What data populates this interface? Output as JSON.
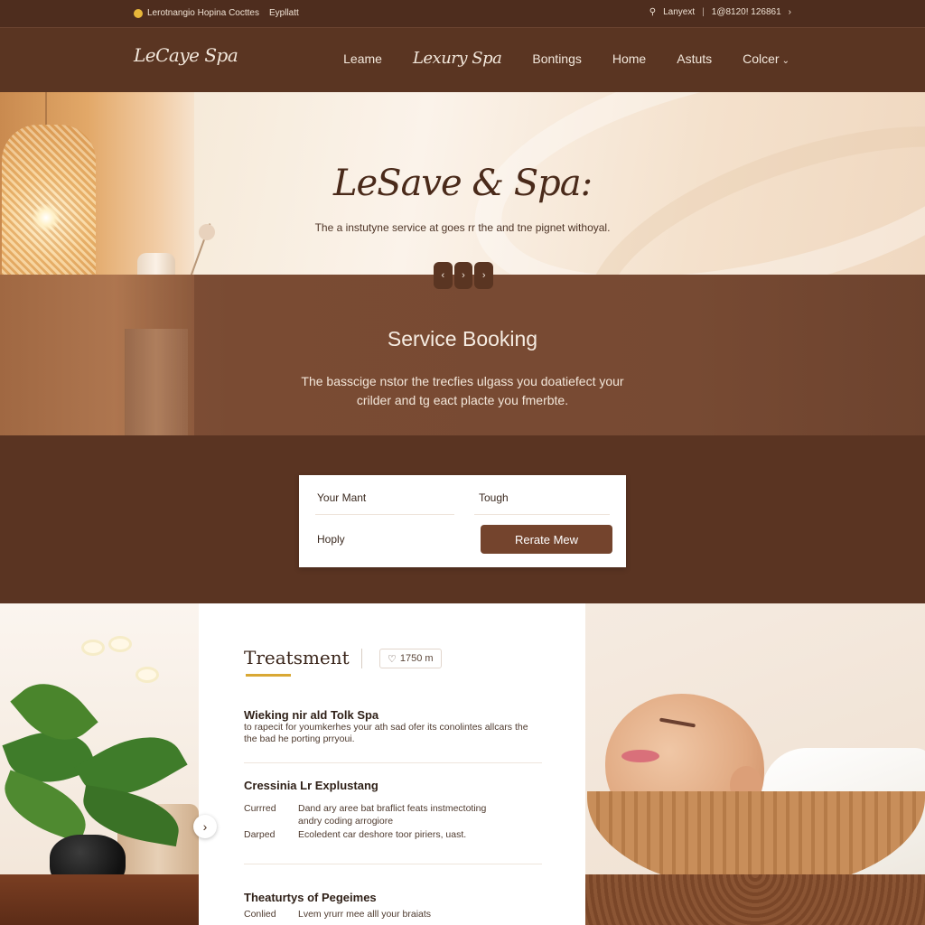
{
  "topbar": {
    "left_text": "Lerotnangio Hopina Cocttes",
    "left_sub": "Eypllatt",
    "right_label": "Lanyext",
    "right_phone": "1@8120! 126861"
  },
  "nav": {
    "logo": "LeCaye Spa",
    "links": [
      "Leame",
      "Lexury Spa",
      "Bontings",
      "Home",
      "Astuts",
      "Colcer"
    ]
  },
  "hero": {
    "title": "LeSave & Spa:",
    "subtitle": "The a instutyne service at goes rr the and tne pignet withoyal.",
    "carousel": [
      "‹",
      "›",
      "›"
    ]
  },
  "booking": {
    "title": "Service Booking",
    "text": "The basscige nstor the trecfies ulgass you doatiefect your crilder and tg eact placte you fmerbte."
  },
  "form": {
    "field1": "Your Mant",
    "field2": "Tough",
    "field3": "Hoply",
    "button": "Rerate Mew"
  },
  "treatment": {
    "title": "Treatsment",
    "badge": "1750 m",
    "s1_title": "Wieking nir ald Tolk Spa",
    "s1_text": "to rapecit for youmkerhes your ath sad ofer its conolintes allcars the the bad he porting prryoui.",
    "s2_title": "Cressinia Lr Explustang",
    "bullets": [
      {
        "label": "Currred",
        "text": "Dand ary aree bat braflict feats instmectoting andry coding arrogiore"
      },
      {
        "label": "Darped",
        "text": "Ecoledent car deshore toor piriers, uast."
      }
    ],
    "s3_title": "Theaturtys of Pegeimes",
    "s3_bullet": {
      "label": "Conlied",
      "text": "Lvem yrurr mee alll your braiats"
    }
  },
  "colors": {
    "brown_dark": "#4e2d1e",
    "brown": "#5a3522",
    "accent_gold": "#d9a834",
    "button": "#74442d"
  },
  "icons": {
    "topbar_left": "sun-dot-icon",
    "topbar_search": "search-icon",
    "topbar_next": "chevron-right-icon",
    "nav_dropdown": "chevron-down-icon",
    "badge": "location-pin-icon",
    "carousel_next": "chevron-right-icon"
  }
}
